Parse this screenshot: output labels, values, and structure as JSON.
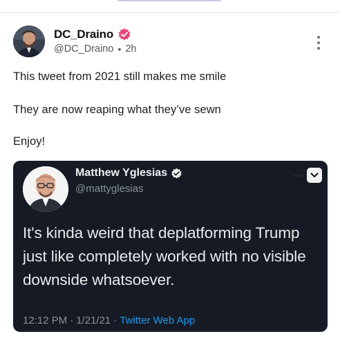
{
  "post": {
    "author_name": "DC_Draino",
    "author_handle": "@DC_Draino",
    "separator": "•",
    "time": "2h",
    "lines": [
      "This tweet from 2021 still makes me smile",
      "They are now reaping what they’ve sewn",
      "Enjoy!"
    ],
    "verified_color": "#e8457a"
  },
  "embedded_tweet": {
    "author_name": "Matthew Yglesias",
    "author_handle": "@mattyglesias",
    "text": "It's kinda weird that deplatforming Trump just like completely worked with no visible downside whatsoever.",
    "time": "12:12 PM",
    "separator": "·",
    "date": "1/21/21",
    "app": "Twitter Web App",
    "link_color": "#1d9bf0",
    "background": "#151a24"
  },
  "icons": {
    "more": "more-vertical-icon",
    "verified": "verified-badge-icon",
    "caret": "chevron-down-icon"
  }
}
